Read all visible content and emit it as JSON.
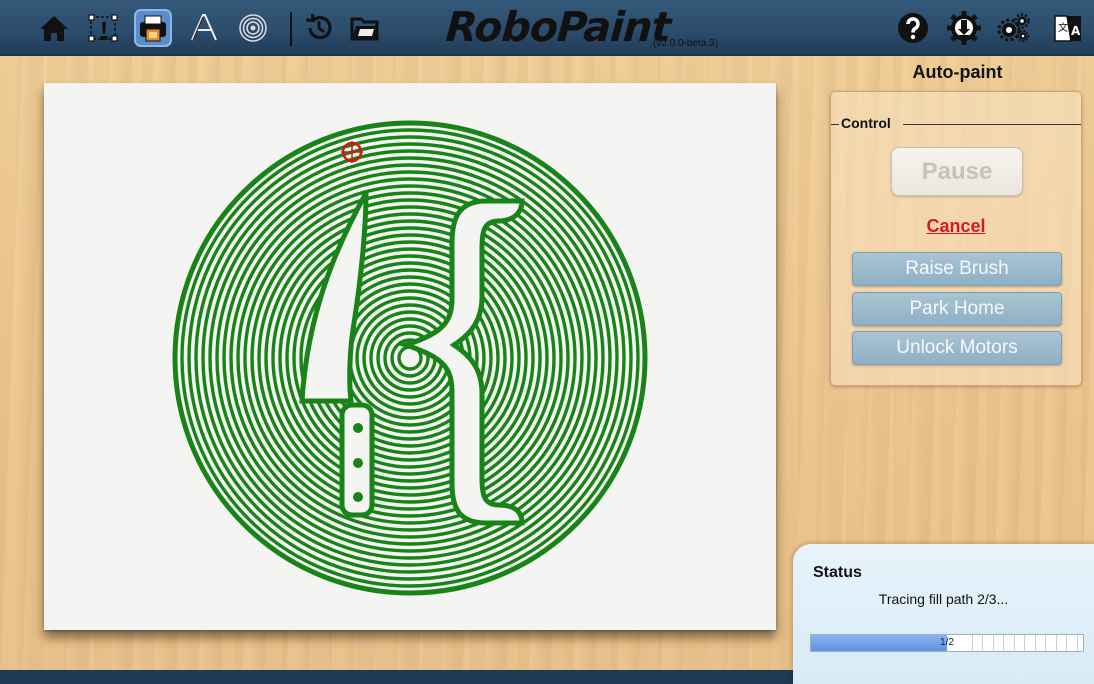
{
  "app": {
    "title": "RoboPaint",
    "version": "(v2.0.0-beta.3)"
  },
  "toolbar": {
    "left_icons": [
      "home-icon",
      "edit-icon",
      "print-icon",
      "text-icon",
      "spiral-icon",
      "history-icon",
      "open-folder-icon"
    ],
    "active": "print-icon",
    "right_icons": [
      "help-icon",
      "settings-download-icon",
      "gears-icon",
      "language-icon"
    ]
  },
  "mode": {
    "title": "Auto-paint"
  },
  "control": {
    "legend": "Control",
    "pause_label": "Pause",
    "cancel_label": "Cancel",
    "buttons": [
      "Raise Brush",
      "Park Home",
      "Unlock Motors"
    ]
  },
  "status": {
    "title": "Status",
    "message": "Tracing fill path 2/3...",
    "progress_label": "1/2",
    "progress_fraction": 0.5
  },
  "colors": {
    "paint": "#188418",
    "accent": "#5b8cc9",
    "cancel": "#d7181c"
  }
}
